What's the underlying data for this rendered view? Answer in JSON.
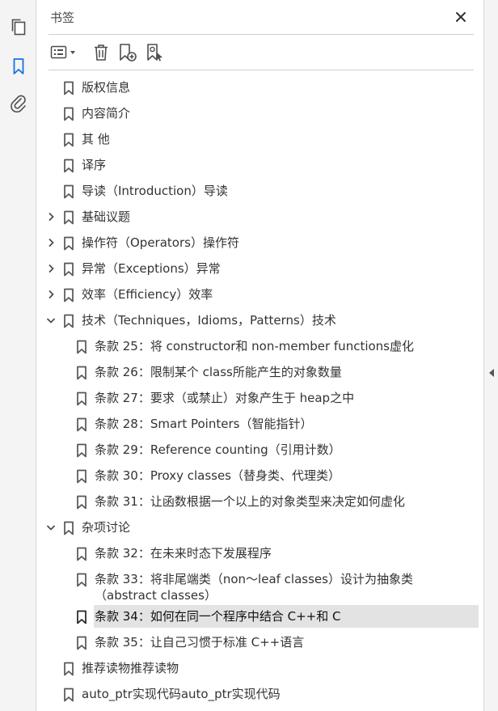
{
  "panel": {
    "title": "书签"
  },
  "icons": {
    "pages": "pages-icon",
    "bookmarks": "bookmark-icon",
    "attachments": "paperclip-icon",
    "close": "close-icon",
    "options": "options-menu-icon",
    "delete": "trash-icon",
    "new_bookmark": "new-bookmark-icon",
    "new_from_structure": "bookmark-from-structure-icon",
    "collapse": "collapse-arrow-icon"
  },
  "colors": {
    "accent": "#1473e6",
    "selection": "#e3e3e3"
  },
  "bookmarks": [
    {
      "label": "版权信息",
      "level": 0,
      "expand": ""
    },
    {
      "label": "内容简介",
      "level": 0,
      "expand": ""
    },
    {
      "label": "其 他",
      "level": 0,
      "expand": ""
    },
    {
      "label": "译序",
      "level": 0,
      "expand": ""
    },
    {
      "label": "导读（Introduction）导读",
      "level": 0,
      "expand": ""
    },
    {
      "label": "基础议题",
      "level": 0,
      "expand": "collapsed"
    },
    {
      "label": "操作符（Operators）操作符",
      "level": 0,
      "expand": "collapsed"
    },
    {
      "label": "异常（Exceptions）异常",
      "level": 0,
      "expand": "collapsed"
    },
    {
      "label": "效率（Efficiency）效率",
      "level": 0,
      "expand": "collapsed"
    },
    {
      "label": "技术（Techniques，Idioms，Patterns）技术",
      "level": 0,
      "expand": "expanded"
    },
    {
      "label": "条款 25：将 constructor和 non-member functions虚化",
      "level": 1,
      "expand": ""
    },
    {
      "label": "条款 26：限制某个 class所能产生的对象数量",
      "level": 1,
      "expand": ""
    },
    {
      "label": "条款 27：要求（或禁止）对象产生于 heap之中",
      "level": 1,
      "expand": ""
    },
    {
      "label": "条款 28：Smart Pointers（智能指针）",
      "level": 1,
      "expand": ""
    },
    {
      "label": "条款 29：Reference counting（引用计数）",
      "level": 1,
      "expand": ""
    },
    {
      "label": "条款 30：Proxy classes（替身类、代理类）",
      "level": 1,
      "expand": ""
    },
    {
      "label": "条款 31：让函数根据一个以上的对象类型来决定如何虚化",
      "level": 1,
      "expand": ""
    },
    {
      "label": "杂项讨论",
      "level": 0,
      "expand": "expanded"
    },
    {
      "label": "条款 32：在未来时态下发展程序",
      "level": 1,
      "expand": ""
    },
    {
      "label": "条款 33：将非尾端类（non～leaf classes）设计为抽象类（abstract classes）",
      "level": 1,
      "expand": "",
      "tall": true
    },
    {
      "label": "条款 34：如何在同一个程序中结合 C++和 C",
      "level": 1,
      "expand": "",
      "selected": true
    },
    {
      "label": "条款 35：让自己习惯于标准 C++语言",
      "level": 1,
      "expand": ""
    },
    {
      "label": "推荐读物推荐读物",
      "level": 0,
      "expand": ""
    },
    {
      "label": "auto_ptr实现代码auto_ptr实现代码",
      "level": 0,
      "expand": ""
    }
  ]
}
